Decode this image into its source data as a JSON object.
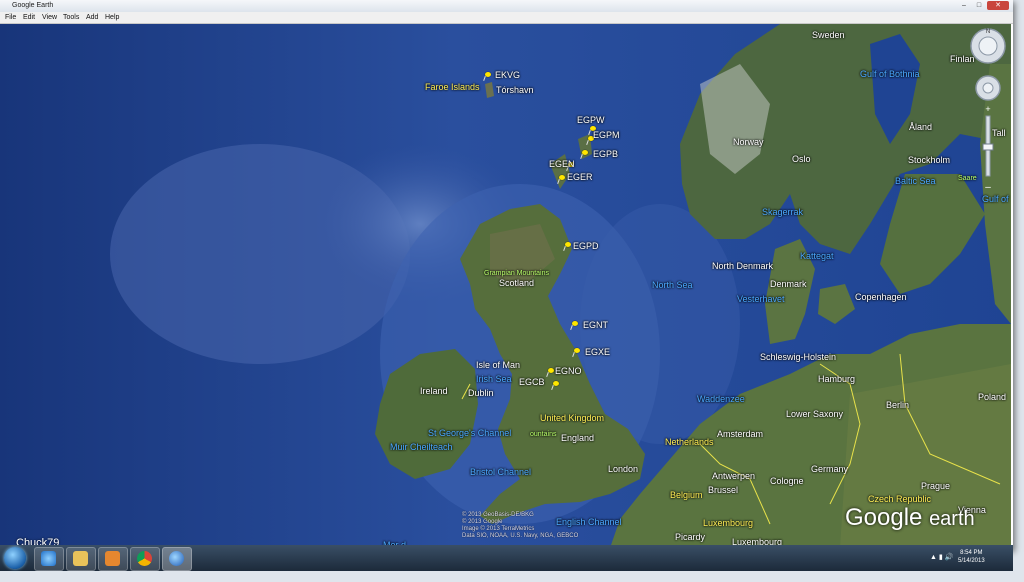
{
  "window": {
    "title": "Google Earth",
    "minimize": "–",
    "maximize": "□",
    "close": "✕"
  },
  "menu": [
    "File",
    "Edit",
    "View",
    "Tools",
    "Add",
    "Help"
  ],
  "airports": [
    {
      "code": "EKVG"
    },
    {
      "code": "EGPW"
    },
    {
      "code": "EGPM"
    },
    {
      "code": "EGPB"
    },
    {
      "code": "EGEN"
    },
    {
      "code": "EGER"
    },
    {
      "code": "EGPD"
    },
    {
      "code": "EGNT"
    },
    {
      "code": "EGXE"
    },
    {
      "code": "EGNO"
    },
    {
      "code": "EGCB"
    }
  ],
  "places": {
    "faroe": "Faroe Islands",
    "torshavn": "Tórshavn",
    "sweden": "Sweden",
    "finland": "Finlan",
    "norway": "Norway",
    "oslo": "Oslo",
    "stockholm": "Stockholm",
    "aland": "Åland",
    "tallinn": "Tall",
    "saare": "Saare",
    "scotland": "Scotland",
    "grampian": "Grampian Mountains",
    "north_denmark": "North Denmark",
    "denmark": "Denmark",
    "copenhagen": "Copenhagen",
    "isle_of_man": "Isle of Man",
    "ireland": "Ireland",
    "dublin": "Dublin",
    "united_kingdom": "United Kingdom",
    "england": "England",
    "london": "London",
    "schleswig": "Schleswig-Holstein",
    "hamburg": "Hamburg",
    "berlin": "Berlin",
    "poland": "Poland",
    "lower_saxony": "Lower Saxony",
    "amsterdam": "Amsterdam",
    "netherlands": "Netherlands",
    "germany": "Germany",
    "antwerpen": "Antwerpen",
    "cologne": "Cologne",
    "belgium": "Belgium",
    "brussel": "Brussel",
    "prague": "Prague",
    "czech": "Czech Republic",
    "luxembourg1": "Luxembourg",
    "luxembourg2": "Luxembourg",
    "picardy": "Picardy",
    "vienna": "Vienna",
    "mountains": "ountains"
  },
  "water": {
    "gulf_bothnia": "Gulf of Bothnia",
    "baltic": "Baltic Sea",
    "gulf_fin": "Gulf of",
    "skagerrak": "Skagerrak",
    "kattegat": "Kattegat",
    "north_sea": "North Sea",
    "vesterhavet": "Vesterhavet",
    "irish_sea": "Irish Sea",
    "st_george": "St George's Channel",
    "muir": "Muir Cheilteach",
    "bristol": "Bristol Channel",
    "english": "English Channel",
    "waddenzee": "Waddenzee",
    "mer": "Mer d"
  },
  "credits": [
    "© 2013 GeoBasis-DE/BKG",
    "© 2013 Google",
    "Image © 2013 TerraMetrics",
    "Data SIO, NOAA, U.S. Navy, NGA, GEBCO"
  ],
  "logo": {
    "brand": "Google",
    "product": "earth"
  },
  "author": "Chuck79",
  "taskbar": {
    "time": "8:54 PM",
    "date": "5/14/2013"
  },
  "colors": {
    "ocean": "#1f3f88",
    "land": "#4f6a3a",
    "pin": "#ffe600"
  }
}
